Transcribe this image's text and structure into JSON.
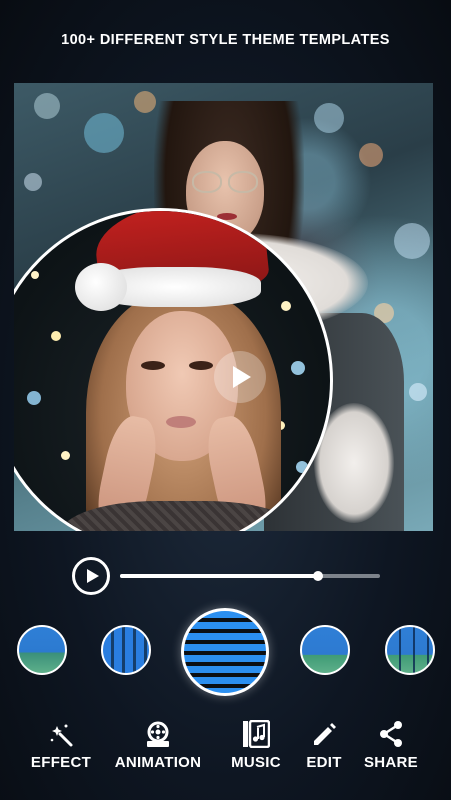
{
  "header": {
    "title": "100+ DIFFERENT STYLE THEME TEMPLATES"
  },
  "player": {
    "progress": 0.76
  },
  "themes": [
    {
      "name": "theme-1",
      "selected": false
    },
    {
      "name": "theme-2",
      "selected": false
    },
    {
      "name": "theme-3",
      "selected": true
    },
    {
      "name": "theme-4",
      "selected": false
    },
    {
      "name": "theme-5",
      "selected": false
    }
  ],
  "toolbar": {
    "effect": {
      "label": "EFFECT",
      "icon": "magic-wand-icon"
    },
    "animation": {
      "label": "ANIMATION",
      "icon": "film-reel-icon"
    },
    "music": {
      "label": "MUSIC",
      "icon": "music-library-icon"
    },
    "edit": {
      "label": "EDIT",
      "icon": "pencil-icon"
    },
    "share": {
      "label": "SHARE",
      "icon": "share-icon"
    }
  },
  "colors": {
    "accent": "#2b8ff0",
    "background": "#0e1622",
    "text": "#ffffff"
  }
}
